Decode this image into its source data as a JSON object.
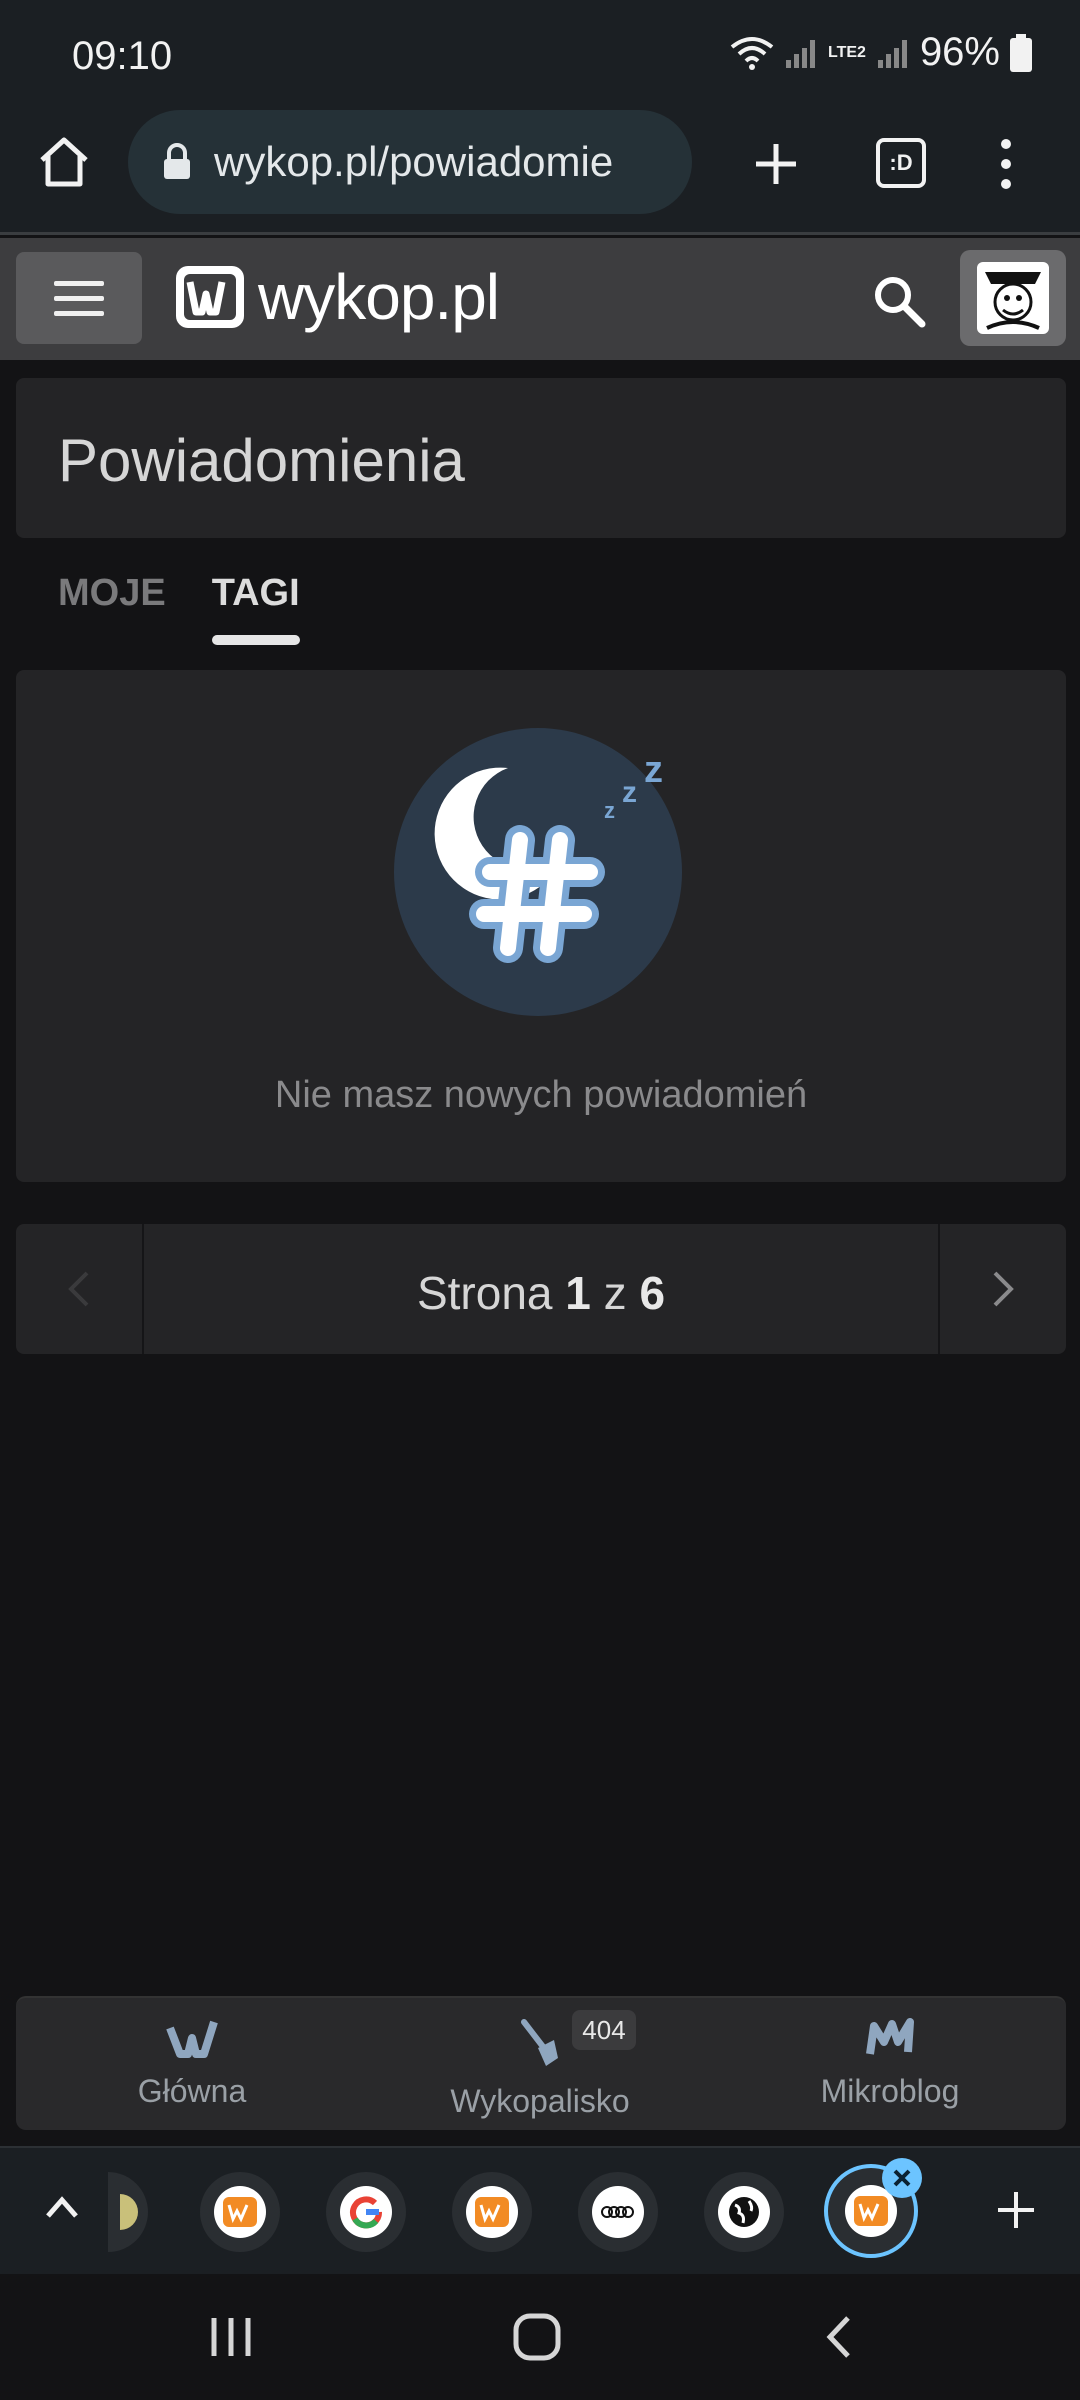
{
  "status": {
    "time": "09:10",
    "battery": "96%",
    "network": "LTE2"
  },
  "browser": {
    "url": "wykop.pl/powiadomie",
    "tab_count": ":D"
  },
  "site": {
    "logo": "wykop.pl"
  },
  "page": {
    "title": "Powiadomienia"
  },
  "tabs": [
    {
      "label": "MOJE"
    },
    {
      "label": "TAGI"
    }
  ],
  "empty": {
    "message": "Nie masz nowych powiadomień"
  },
  "pagination": {
    "prefix": "Strona",
    "current": "1",
    "sep": "z",
    "total": "6"
  },
  "bottom_nav": {
    "items": [
      {
        "label": "Główna"
      },
      {
        "label": "Wykopalisko"
      },
      {
        "label": "Mikroblog"
      }
    ],
    "badge": "404"
  },
  "colors": {
    "accent": "#f28b24",
    "illustration_bg": "#2c3a4a",
    "hash_blue": "#7aa6d4"
  }
}
